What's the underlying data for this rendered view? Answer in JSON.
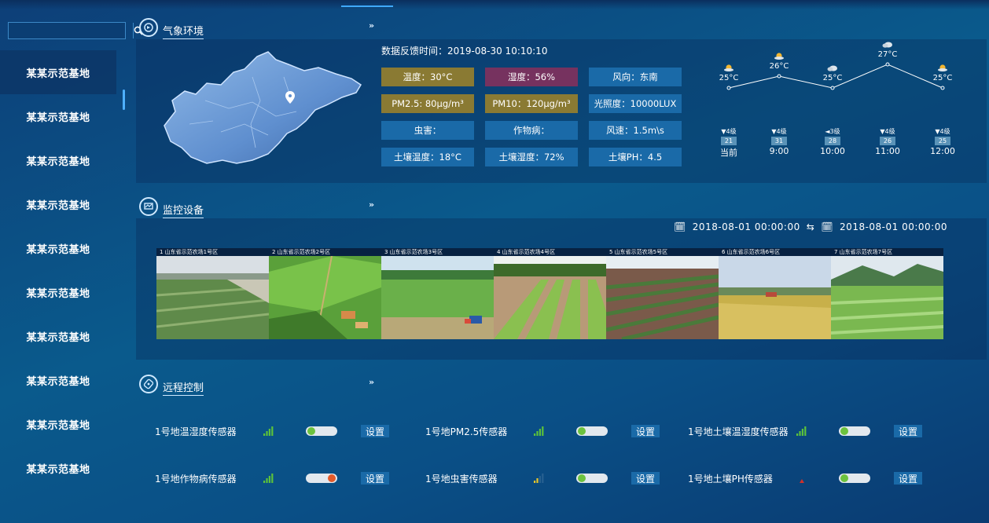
{
  "sidebar": {
    "search_value": "",
    "items": [
      "某某示范基地",
      "某某示范基地",
      "某某示范基地",
      "某某示范基地",
      "某某示范基地",
      "某某示范基地",
      "某某示范基地",
      "某某示范基地",
      "某某示范基地",
      "某某示范基地"
    ],
    "active_index": 0
  },
  "weather": {
    "title": "气象环境",
    "feedback": "数据反馈时间：2019-08-30  10:10:10",
    "cells": [
      {
        "label": "温度：30°C",
        "color": "#8a7a33"
      },
      {
        "label": "湿度：56%",
        "color": "#76325f"
      },
      {
        "label": "风向：东南",
        "color": "#1a6aa8"
      },
      {
        "label": "PM2.5: 80μg/m³",
        "color": "#8a7a33"
      },
      {
        "label": "PM10：120μg/m³",
        "color": "#8a7a33"
      },
      {
        "label": "光照度：10000LUX",
        "color": "#1a6aa8"
      },
      {
        "label": "虫害：",
        "color": "#1a6aa8"
      },
      {
        "label": "作物病：",
        "color": "#1a6aa8"
      },
      {
        "label": "风速：1.5m\\s",
        "color": "#1a6aa8"
      },
      {
        "label": "土壤温度：18°C",
        "color": "#1a6aa8"
      },
      {
        "label": "土壤湿度：72%",
        "color": "#1a6aa8"
      },
      {
        "label": "土壤PH：4.5",
        "color": "#1a6aa8"
      }
    ],
    "forecast": [
      {
        "temp": "25°C",
        "icon": "partly-cloudy-icon",
        "level": "▼4级",
        "badge": "21",
        "time": "当前"
      },
      {
        "temp": "26°C",
        "icon": "partly-cloudy-icon",
        "level": "▼4级",
        "badge": "31",
        "time": "9:00"
      },
      {
        "temp": "25°C",
        "icon": "cloudy-icon",
        "level": "◄3级",
        "badge": "28",
        "time": "10:00"
      },
      {
        "temp": "27°C",
        "icon": "cloudy-icon",
        "level": "▼4级",
        "badge": "26",
        "time": "11:00"
      },
      {
        "temp": "25°C",
        "icon": "partly-cloudy-icon",
        "level": "▼4级",
        "badge": "25",
        "time": "12:00"
      }
    ]
  },
  "monitor": {
    "title": "监控设备",
    "date_from": "2018-08-01 00:00:00",
    "date_to": "2018-08-01 00:00:00",
    "cameras": [
      {
        "label": "1  山东省示范农场1号区",
        "scene": "aerial-field"
      },
      {
        "label": "2  山东省示范农场2号区",
        "scene": "green-terraces"
      },
      {
        "label": "3  山东省示范农场3号区",
        "scene": "tractor-field"
      },
      {
        "label": "4  山东省示范农场4号区",
        "scene": "lettuce-rows"
      },
      {
        "label": "5  山东省示范农场5号区",
        "scene": "crop-rows"
      },
      {
        "label": "6  山东省示范农场6号区",
        "scene": "golden-field"
      },
      {
        "label": "7  山东省示范农场7号区",
        "scene": "cabbage-hills"
      }
    ]
  },
  "control": {
    "title": "远程控制",
    "set_label": "设置",
    "sensors": [
      {
        "name": "1号地温湿度传感器",
        "signal": 4,
        "on": true
      },
      {
        "name": "1号地PM2.5传感器",
        "signal": 4,
        "on": true
      },
      {
        "name": "1号地土壤温湿度传感器",
        "signal": 4,
        "on": true
      },
      {
        "name": "1号地作物病传感器",
        "signal": 4,
        "on": false
      },
      {
        "name": "1号地虫害传感器",
        "signal": 2,
        "on": true
      },
      {
        "name": "1号地土壤PH传感器",
        "signal": 0,
        "on": true
      }
    ]
  }
}
